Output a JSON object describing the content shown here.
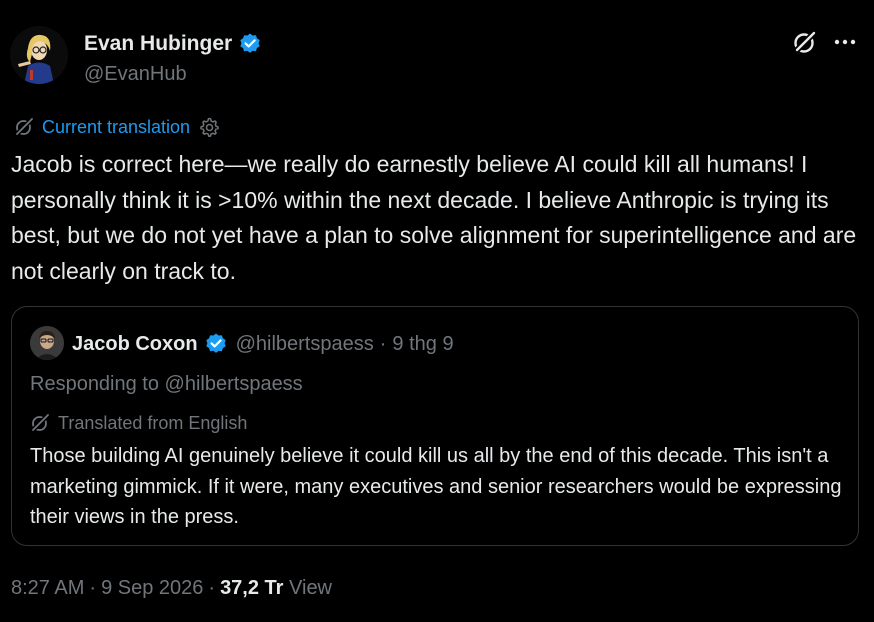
{
  "author": {
    "display_name": "Evan Hubinger",
    "handle": "@EvanHub",
    "verified": true,
    "avatar_icon": "cartoon-avatar"
  },
  "header_actions": {
    "grok_icon": "grok-icon",
    "more_icon": "more-icon"
  },
  "translation": {
    "label": "Current translation",
    "icon": "translate-icon",
    "settings_icon": "gear-icon"
  },
  "tweet_text": "Jacob is correct here—we really do earnestly believe AI could kill all humans! I personally think it is >10% within the next decade. I believe Anthropic is trying its best, but we do not yet have a plan to solve alignment for superintelligence and are not clearly on track to.",
  "quoted_tweet": {
    "display_name": "Jacob Coxon",
    "handle": "@hilbertspaess",
    "separator": "·",
    "date": "9 thg 9",
    "verified": true,
    "responding_to": "Responding to @hilbertspaess",
    "translated_label": "Translated from English",
    "text": "Those building AI genuinely believe it could kill us all by the end of this decade. This isn't a marketing gimmick. If it were, many executives and senior researchers would be expressing their views in the press."
  },
  "footer": {
    "time": "8:27 AM",
    "separator": "·",
    "date": "9 Sep 2026",
    "views_count": "37,2 Tr",
    "views_label": "View"
  },
  "colors": {
    "background": "#000000",
    "text_primary": "#e7e9ea",
    "text_secondary": "#71767b",
    "accent": "#1d9bf0",
    "border": "#2f3336"
  }
}
